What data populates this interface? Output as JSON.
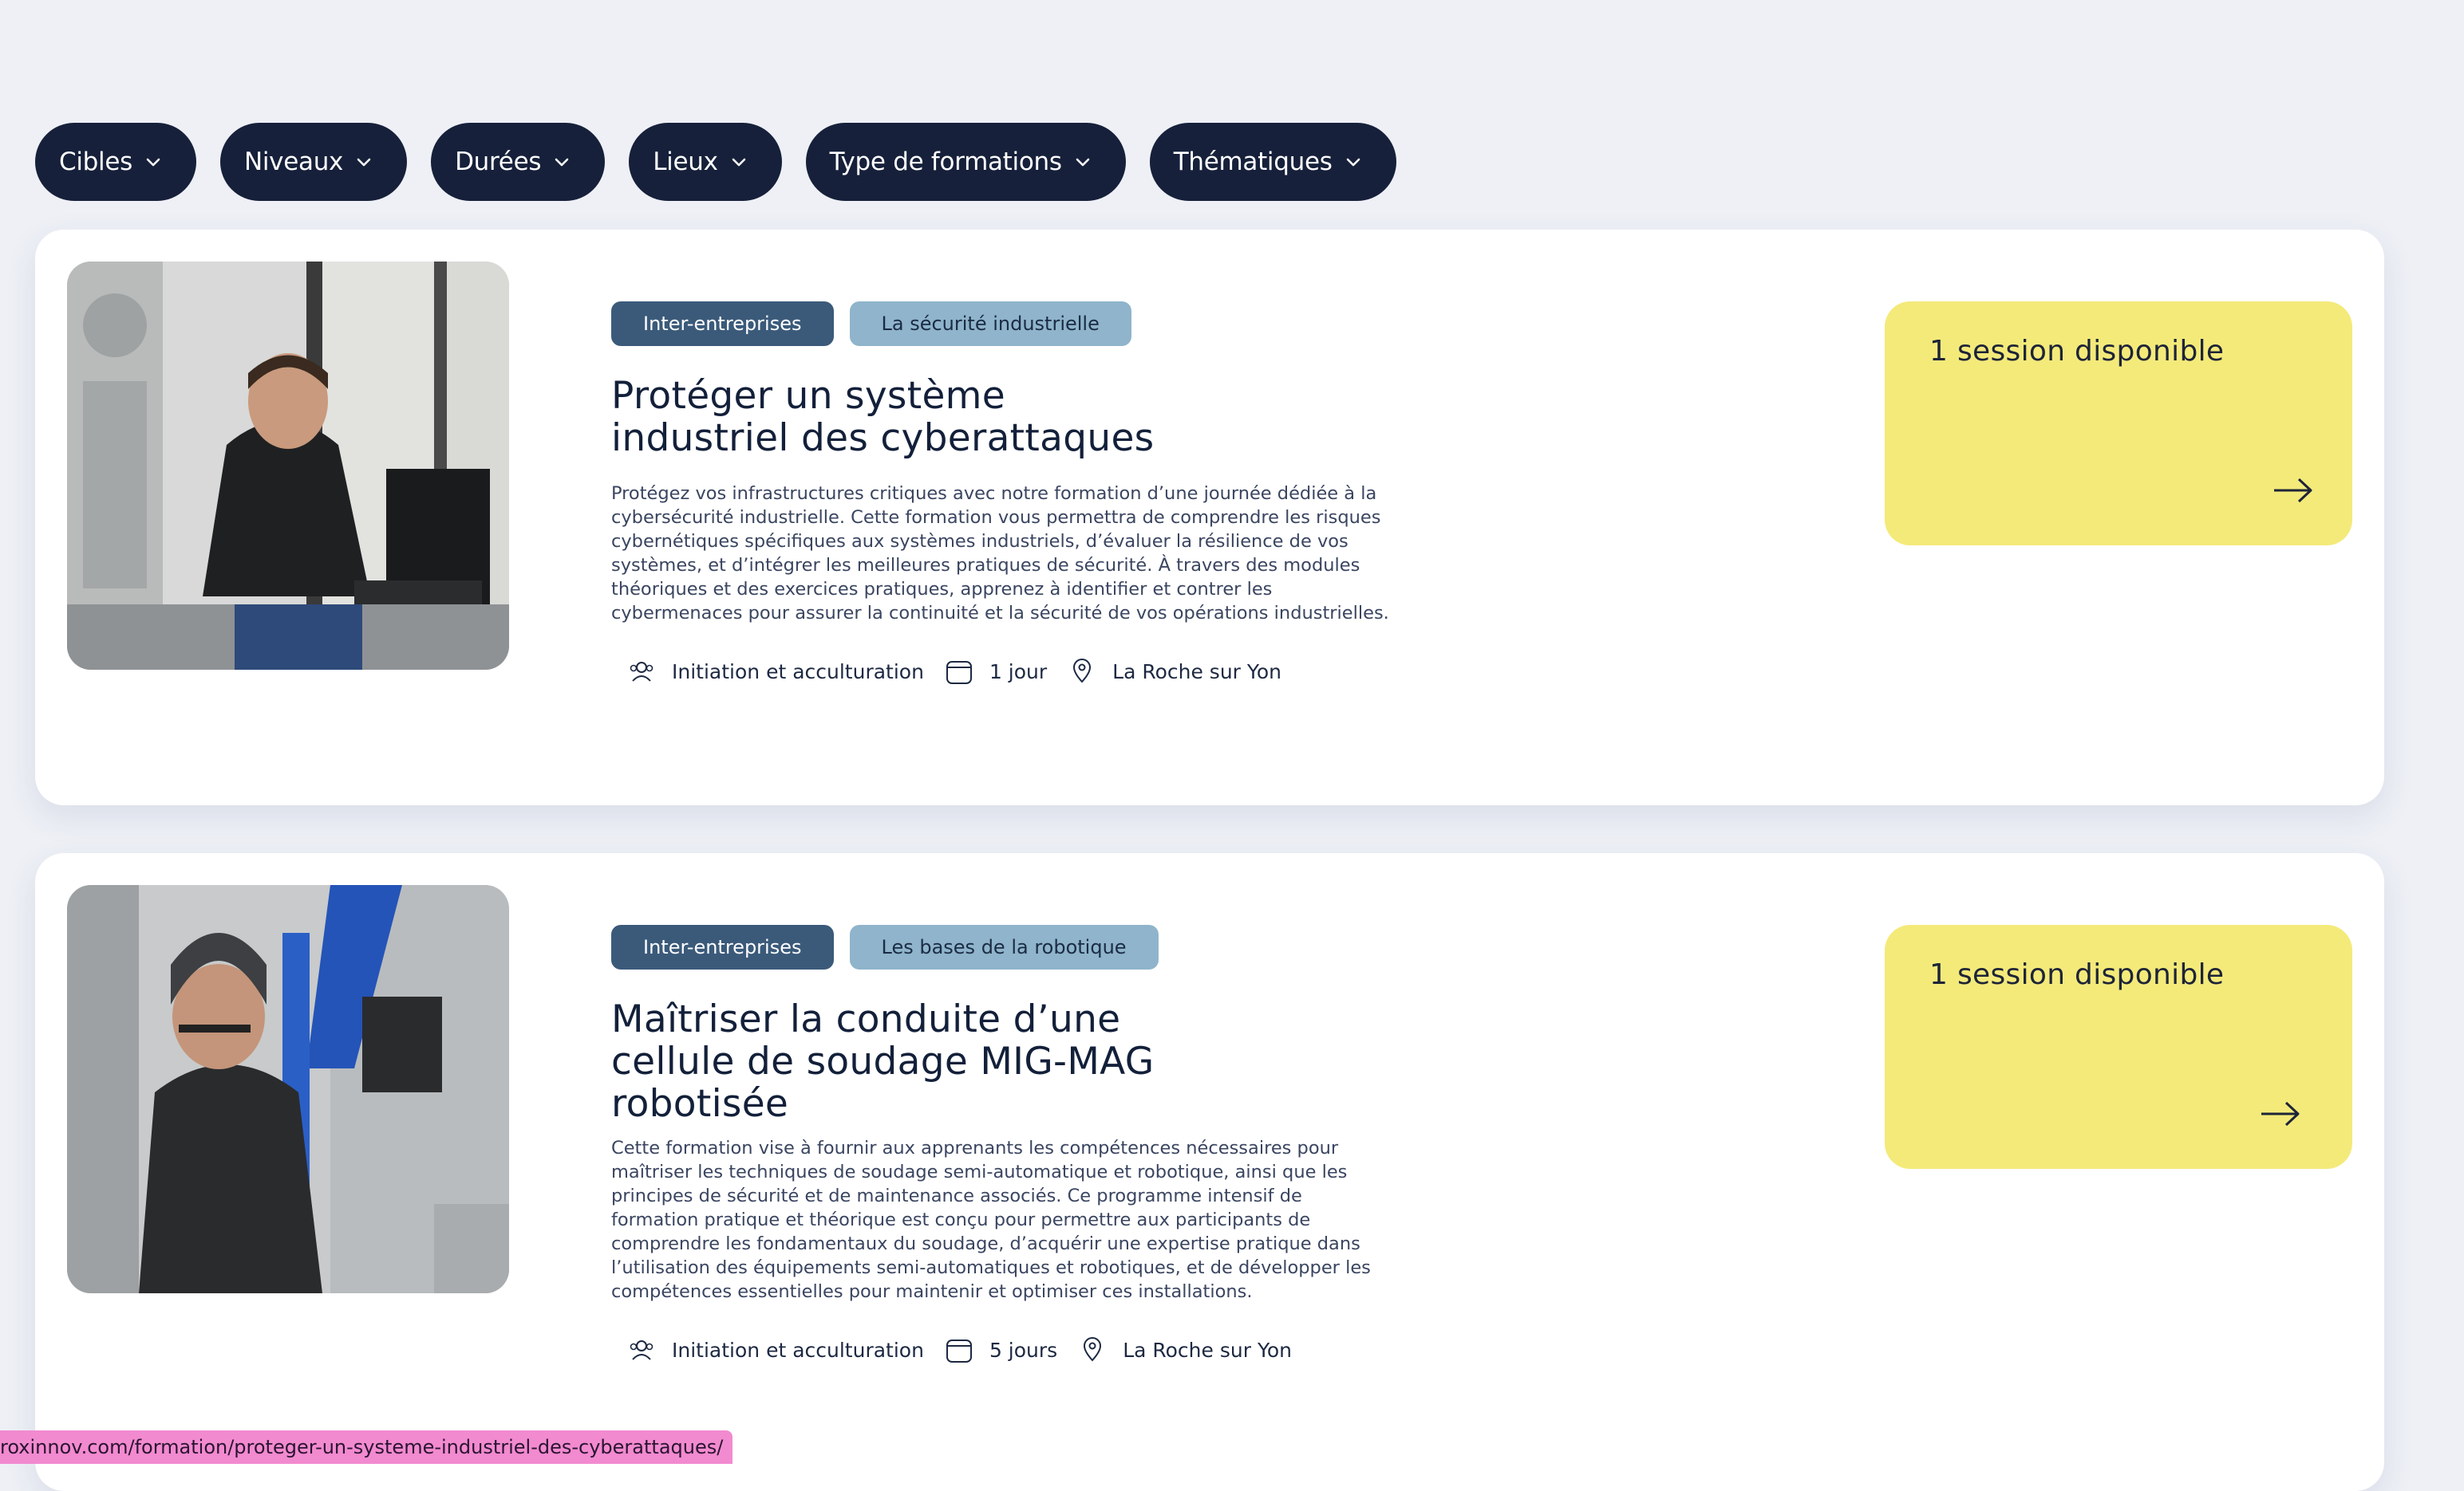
{
  "filters": [
    {
      "label": "Cibles"
    },
    {
      "label": "Niveaux"
    },
    {
      "label": "Durées"
    },
    {
      "label": "Lieux"
    },
    {
      "label": "Type de formations"
    },
    {
      "label": "Thématiques"
    }
  ],
  "cards": [
    {
      "tags": [
        "Inter-entreprises",
        "La sécurité industrielle"
      ],
      "title_lines": [
        "Protéger un système",
        "industriel des cyberattaques"
      ],
      "description": "Protégez vos infrastructures critiques avec notre formation d’une journée dédiée à la cybersécurité industrielle. Cette formation vous permettra de comprendre les risques cybernétiques spécifiques aux systèmes industriels, d’évaluer la résilience de vos systèmes, et d’intégrer les meilleures pratiques de sécurité. À travers des modules théoriques et des exercices pratiques, apprenez à identifier et contrer les cybermenaces pour assurer la continuité et la sécurité de vos opérations industrielles.",
      "level": "Initiation et acculturation",
      "duration": "1 jour",
      "location": "La Roche sur Yon",
      "session": "1 session disponible"
    },
    {
      "tags": [
        "Inter-entreprises",
        "Les bases de la robotique"
      ],
      "title_lines": [
        "Maîtriser la conduite d’une",
        "cellule de soudage MIG-MAG",
        "robotisée"
      ],
      "description": "Cette formation vise à fournir aux apprenants les compétences nécessaires pour maîtriser les techniques de soudage semi-automatique et robotique, ainsi que les principes de sécurité et de maintenance associés. Ce programme intensif de formation pratique et théorique est conçu pour permettre aux participants de comprendre les fondamentaux du soudage, d’acquérir une expertise pratique dans l’utilisation des équipements semi-automatiques et robotiques, et de développer les compétences essentielles pour maintenir et optimiser ces installations.",
      "level": "Initiation et acculturation",
      "duration": "5 jours",
      "location": "La Roche sur Yon",
      "session": "1 session disponible"
    }
  ],
  "status_bar": {
    "url": "roxinnov.com/formation/proteger-un-systeme-industriel-des-cyberattaques/"
  },
  "colors": {
    "background": "#eef0f6",
    "pill": "#16203a",
    "tag_dark": "#3b5a7a",
    "tag_light": "#8fb4cb",
    "session": "#f4ea7a",
    "status_bar": "#f28ad0"
  },
  "icons": {
    "filter_chevron": "chevron-down-icon",
    "level": "user-icon",
    "duration": "calendar-icon",
    "location": "map-pin-icon",
    "session_arrow": "arrow-right-icon"
  }
}
